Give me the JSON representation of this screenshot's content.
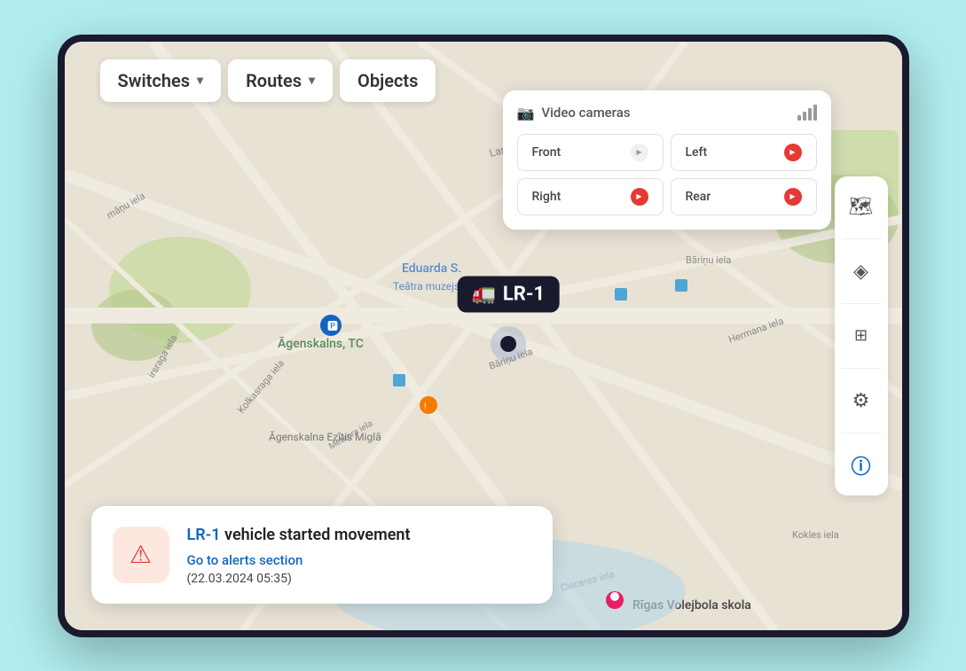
{
  "background_color": "#b2eef0",
  "navbar": {
    "switches_label": "Switches",
    "routes_label": "Routes",
    "objects_label": "Objects"
  },
  "video_panel": {
    "title": "Video cameras",
    "buttons": [
      {
        "label": "Front",
        "active": false
      },
      {
        "label": "Left",
        "active": true
      },
      {
        "label": "Right",
        "active": true
      },
      {
        "label": "Rear",
        "active": true
      }
    ]
  },
  "vehicle": {
    "label": "LR-1",
    "icon": "🚛"
  },
  "alert": {
    "title_vehicle": "LR-1",
    "title_text": " vehicle started movement",
    "link": "Go to alerts section",
    "timestamp": "(22.03.2024 05:35)"
  },
  "toolbar": {
    "buttons": [
      {
        "icon": "🗺",
        "name": "map-icon"
      },
      {
        "icon": "◈",
        "name": "layers-icon"
      },
      {
        "icon": "⊞",
        "name": "tracking-icon"
      },
      {
        "icon": "⚙",
        "name": "settings-icon"
      },
      {
        "icon": "ℹ",
        "name": "info-icon"
      }
    ]
  }
}
